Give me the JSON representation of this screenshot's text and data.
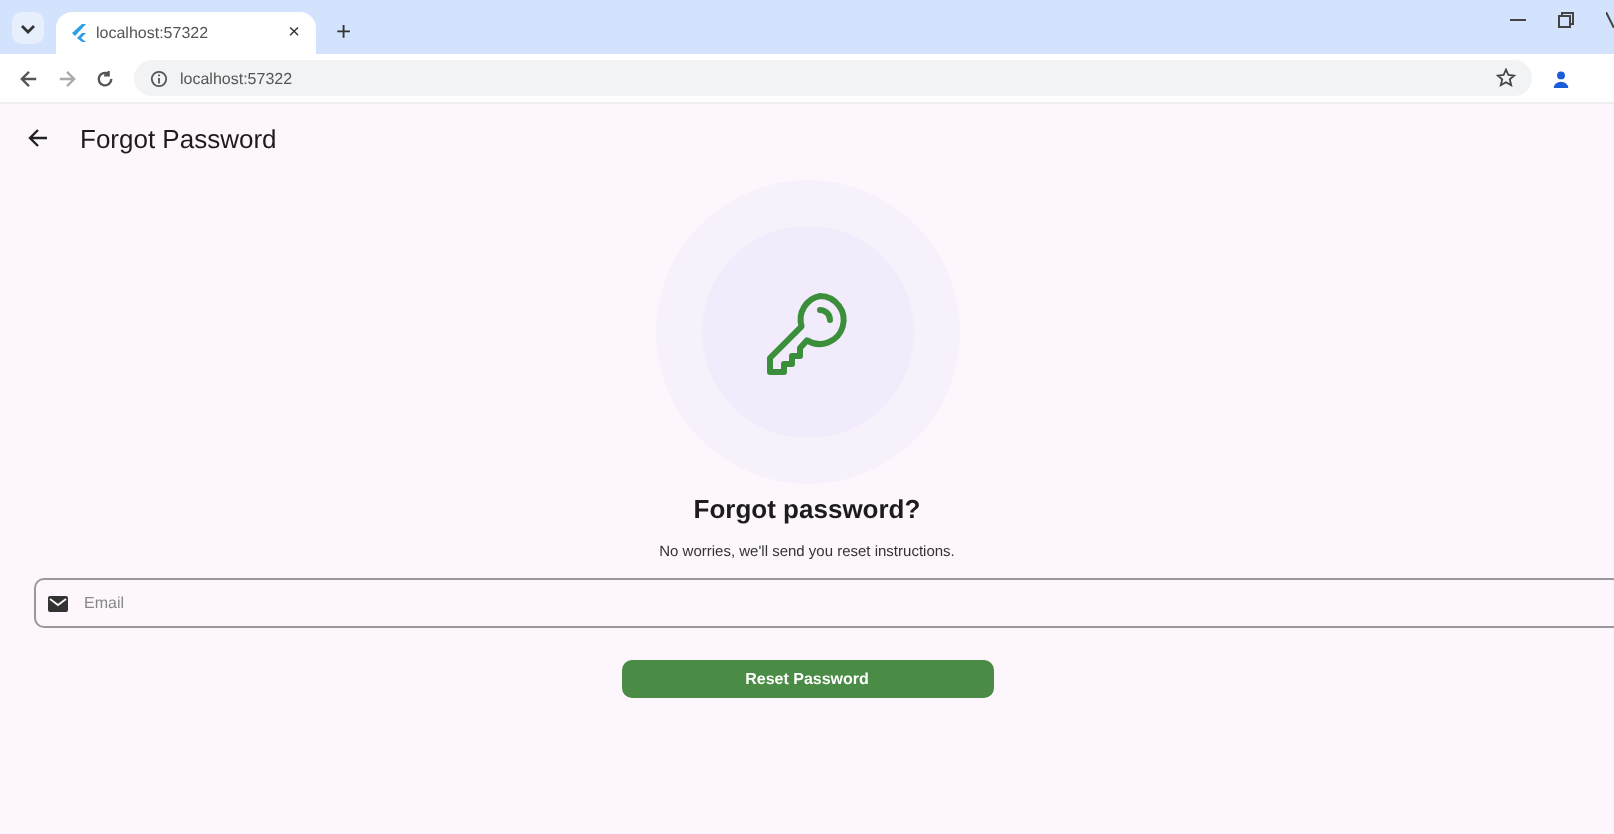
{
  "browser": {
    "tab_title": "localhost:57322",
    "tab_close": "×",
    "new_tab": "+",
    "url": "localhost:57322"
  },
  "app_bar": {
    "title": "Forgot Password"
  },
  "heading": "Forgot password?",
  "subtitle": "No worries, we'll send you reset instructions.",
  "email_field": {
    "placeholder": "Email"
  },
  "button": "Reset Password"
}
